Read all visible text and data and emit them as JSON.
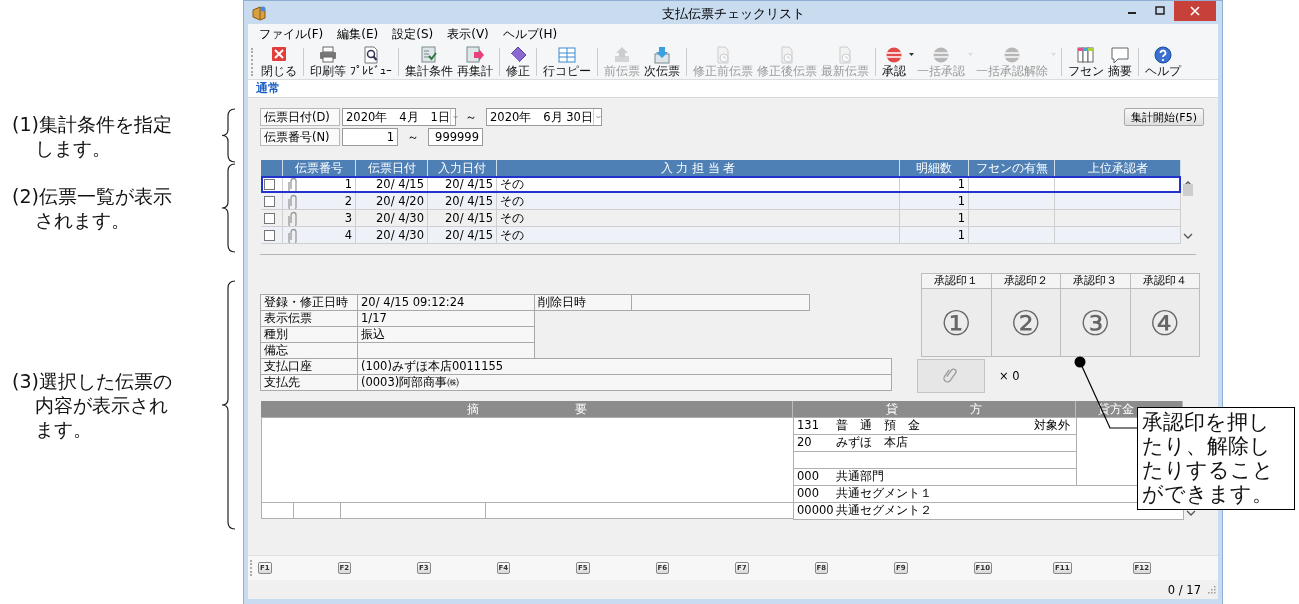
{
  "notes": [
    {
      "lines": [
        "(1)集計条件を指定",
        "します。"
      ]
    },
    {
      "lines": [
        "(2)伝票一覧が表示",
        "されます。"
      ]
    },
    {
      "lines": [
        "(3)選択した伝票の",
        "内容が表示され",
        "ます。"
      ]
    }
  ],
  "window": {
    "title": "支払伝票チェックリスト"
  },
  "menu": [
    "ファイル(F)",
    "編集(E)",
    "設定(S)",
    "表示(V)",
    "ヘルプ(H)"
  ],
  "toolbar": {
    "groups": [
      {
        "items": [
          {
            "label": "閉じる",
            "disabled": false,
            "dropdown": false
          }
        ]
      },
      {
        "items": [
          {
            "label": "印刷等",
            "disabled": false,
            "dropdown": false
          },
          {
            "label": "ﾌﾟﾚﾋﾞｭｰ",
            "disabled": false,
            "dropdown": false
          }
        ]
      },
      {
        "items": [
          {
            "label": "集計条件",
            "disabled": false,
            "dropdown": false
          },
          {
            "label": "再集計",
            "disabled": false,
            "dropdown": false
          }
        ]
      },
      {
        "items": [
          {
            "label": "修正",
            "disabled": false,
            "dropdown": false
          }
        ]
      },
      {
        "items": [
          {
            "label": "行コピー",
            "disabled": false,
            "dropdown": false
          }
        ]
      },
      {
        "items": [
          {
            "label": "前伝票",
            "disabled": true,
            "dropdown": false
          },
          {
            "label": "次伝票",
            "disabled": false,
            "dropdown": false
          }
        ]
      },
      {
        "items": [
          {
            "label": "修正前伝票",
            "disabled": true,
            "dropdown": false
          },
          {
            "label": "修正後伝票",
            "disabled": true,
            "dropdown": false
          },
          {
            "label": "最新伝票",
            "disabled": true,
            "dropdown": false
          }
        ]
      },
      {
        "items": [
          {
            "label": "承認",
            "disabled": false,
            "dropdown": true
          },
          {
            "label": "一括承認",
            "disabled": true,
            "dropdown": true
          },
          {
            "label": "一括承認解除",
            "disabled": true,
            "dropdown": true
          }
        ]
      },
      {
        "items": [
          {
            "label": "フセン",
            "disabled": false,
            "dropdown": false
          },
          {
            "label": "摘要",
            "disabled": false,
            "dropdown": false
          }
        ]
      },
      {
        "items": [
          {
            "label": "ヘルプ",
            "disabled": false,
            "dropdown": false
          }
        ]
      }
    ]
  },
  "tabs": [
    {
      "label": "通常",
      "selected": true
    }
  ],
  "filters": {
    "date_label": "伝票日付(D)",
    "date_from": "2020年　4月　1日",
    "range_mark_1": "～",
    "date_to": "2020年　6月 30日",
    "run_button": "集計開始(F5)",
    "number_label": "伝票番号(N)",
    "number_from": "1",
    "range_mark_2": "～",
    "number_to": "999999"
  },
  "slip_table": {
    "columns": [
      "伝票番号",
      "伝票日付",
      "入力日付",
      "入 力 担 当 者",
      "明細数",
      "フセンの有無",
      "上位承認者"
    ],
    "rows": [
      {
        "checked": false,
        "selected": true,
        "number": "1",
        "slip_date": "20/ 4/15",
        "entry_date": "20/ 4/15",
        "person": "その",
        "lines": "1"
      },
      {
        "checked": false,
        "selected": false,
        "number": "2",
        "slip_date": "20/ 4/20",
        "entry_date": "20/ 4/15",
        "person": "その",
        "lines": "1"
      },
      {
        "checked": false,
        "selected": false,
        "number": "3",
        "slip_date": "20/ 4/30",
        "entry_date": "20/ 4/15",
        "person": "その",
        "lines": "1"
      },
      {
        "checked": false,
        "selected": false,
        "number": "4",
        "slip_date": "20/ 4/30",
        "entry_date": "20/ 4/15",
        "person": "その",
        "lines": "1"
      }
    ]
  },
  "details": {
    "fields": [
      {
        "kind": "pair",
        "label": "登録・修正日時",
        "value": "20/ 4/15 09:12:24",
        "label2": "削除日時"
      },
      {
        "kind": "short",
        "label": "表示伝票",
        "value": "1/17"
      },
      {
        "kind": "short",
        "label": "種別",
        "value": "振込"
      },
      {
        "kind": "short",
        "label": "備忘"
      },
      {
        "kind": "long",
        "label": "支払口座",
        "value": "(100)みずほ本店0011155"
      },
      {
        "kind": "long",
        "label": "支払先",
        "value": "(0003)阿部商事㈱"
      }
    ],
    "stamps": [
      {
        "label": "承認印１",
        "mark": "①"
      },
      {
        "label": "承認印２",
        "mark": "②"
      },
      {
        "label": "承認印３",
        "mark": "③"
      },
      {
        "label": "承認印４",
        "mark": "④"
      }
    ],
    "attachment": {
      "count": "× 0"
    }
  },
  "entries": {
    "summary_header": "摘　　　　　　　　要",
    "credit_header": "貸　　　　　　方",
    "amount_header": "貸方金",
    "credit_lines": [
      {
        "kind": "account",
        "code": "131",
        "name": "普　通　預　金",
        "note": "対象外"
      },
      {
        "kind": "account",
        "code": "20",
        "name": "みずほ　本店"
      },
      {
        "kind": "blank"
      },
      {
        "kind": "account",
        "code": "000",
        "name": "共通部門"
      },
      {
        "kind": "segment",
        "code": "000",
        "name": "共通セグメント１"
      },
      {
        "kind": "segment",
        "code": "00000",
        "name": "共通セグメント２"
      }
    ]
  },
  "function_keys": [
    "F1",
    "F2",
    "F3",
    "F4",
    "F5",
    "F6",
    "F7",
    "F8",
    "F9",
    "F10",
    "F11",
    "F12"
  ],
  "status": {
    "count": "0 / 17"
  },
  "callout": {
    "lines": [
      "承認印を押し",
      "たり、解除し",
      "たりすること",
      "ができます。"
    ]
  }
}
